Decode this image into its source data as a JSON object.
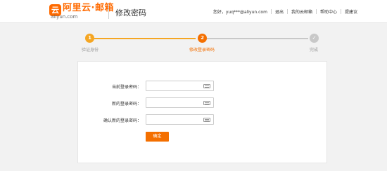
{
  "header": {
    "logo_glyph": "云",
    "logo_text": "阿里云·邮箱",
    "logo_sub": "aliyun.com",
    "page_title": "修改密码",
    "greeting": "您好，yuq***@aliyun.com",
    "nav": [
      "退出",
      "我的云邮箱",
      "帮助中心",
      "提建议"
    ]
  },
  "steps": [
    {
      "number": "1",
      "label": "验证身份",
      "state": "done"
    },
    {
      "number": "2",
      "label": "修改登录密码",
      "state": "active"
    },
    {
      "number": "✓",
      "label": "完成",
      "state": "pending"
    }
  ],
  "colors": {
    "accent": "#f46f00",
    "step_done": "#f5a623",
    "pending": "#c8c8c8"
  },
  "form": {
    "current_password_label": "当前登录密码：",
    "new_password_label": "新的登录密码：",
    "confirm_password_label": "确认新的登录密码：",
    "confirm_button": "确定"
  }
}
